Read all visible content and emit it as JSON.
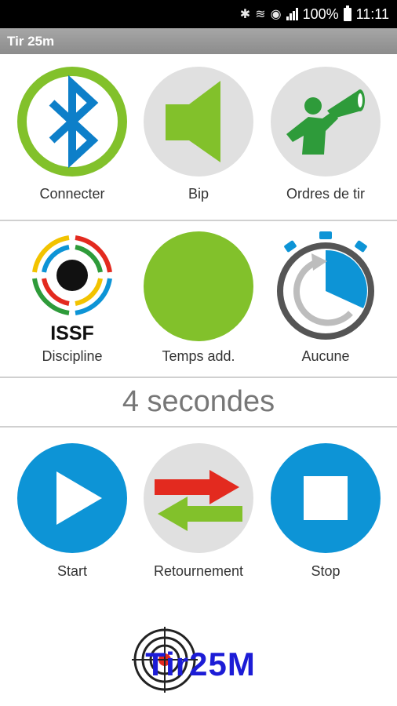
{
  "status_bar": {
    "battery": "100%",
    "time": "11:11",
    "icons": [
      "bluetooth-icon",
      "vibrate-icon",
      "wifi-icon",
      "signal-icon",
      "battery-icon"
    ]
  },
  "app": {
    "title": "Tir 25m"
  },
  "row1": [
    {
      "label": "Connecter",
      "icon": "bluetooth-icon"
    },
    {
      "label": "Bip",
      "icon": "speaker-icon"
    },
    {
      "label": "Ordres de tir",
      "icon": "megaphone-icon"
    }
  ],
  "row2": [
    {
      "label": "Discipline",
      "icon": "issf-target-icon",
      "badge": "ISSF"
    },
    {
      "label": "Temps add.",
      "icon": "green-circle-icon"
    },
    {
      "label": "Aucune",
      "icon": "stopwatch-icon"
    }
  ],
  "delay": {
    "text": "4 secondes"
  },
  "row3": [
    {
      "label": "Start",
      "icon": "play-icon"
    },
    {
      "label": "Retournement",
      "icon": "swap-arrows-icon"
    },
    {
      "label": "Stop",
      "icon": "stop-icon"
    }
  ],
  "logo": {
    "text": "Tir25M"
  },
  "colors": {
    "green": "#82c12b",
    "blue": "#0d94d6",
    "grey_circle": "#e0e0e0",
    "red": "#e32a1f",
    "logo_blue": "#1c1cd6"
  }
}
